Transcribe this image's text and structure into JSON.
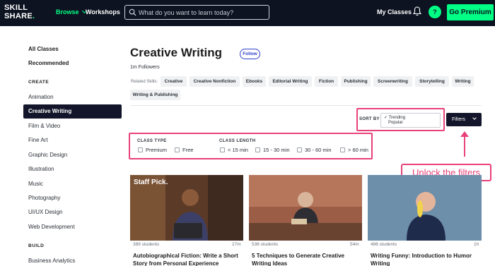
{
  "nav": {
    "logo_line1": "SKILL",
    "logo_line2": "SHARE",
    "logo_dot": ".",
    "browse": "Browse",
    "workshops": "Workshops",
    "search_placeholder": "What do you want to learn today?",
    "my_classes": "My Classes",
    "avatar_initial": "?",
    "go_premium": "Go Premium",
    "accent_color": "#00ff84",
    "bg_color": "#0d1321"
  },
  "sidebar": {
    "all_classes": "All Classes",
    "recommended": "Recommended",
    "create_heading": "CREATE",
    "create_items": [
      "Animation",
      "Creative Writing",
      "Film & Video",
      "Fine Art",
      "Graphic Design",
      "Illustration",
      "Music",
      "Photography",
      "UI/UX Design",
      "Web Development"
    ],
    "active_item": "Creative Writing",
    "build_heading": "BUILD",
    "build_items": [
      "Business Analytics"
    ]
  },
  "main": {
    "title": "Creative Writing",
    "follow": "Follow",
    "followers": "1m Followers",
    "related_label": "Related Skills:",
    "related_skills": [
      "Creative",
      "Creative Nonfiction",
      "Ebooks",
      "Editorial Writing",
      "Fiction",
      "Publishing",
      "Screenwriting",
      "Storytelling",
      "Writing",
      "Writing & Publishing"
    ],
    "sort_by": "SORT BY",
    "sort_options": [
      "✓ Trending",
      "Popular"
    ],
    "filters": "Filters",
    "class_type_label": "CLASS TYPE",
    "class_type_options": [
      "Premium",
      "Free"
    ],
    "class_length_label": "CLASS LENGTH",
    "class_length_options": [
      "< 15 min",
      "15 - 30 min",
      "30 - 60 min",
      "> 60 min"
    ]
  },
  "annotation": {
    "callout": "Unlock the filters",
    "color": "#e8417a"
  },
  "cards": [
    {
      "badge": "Staff Pick.",
      "students": "389 students",
      "duration": "27m",
      "title": "Autobiographical Fiction: Write a Short Story from Personal Experience"
    },
    {
      "badge": "",
      "students": "536 students",
      "duration": "54m",
      "title": "5 Techniques to Generate Creative Writing Ideas"
    },
    {
      "badge": "",
      "students": "486 students",
      "duration": "1h",
      "title": "Writing Funny: Introduction to Humor Writing"
    }
  ]
}
